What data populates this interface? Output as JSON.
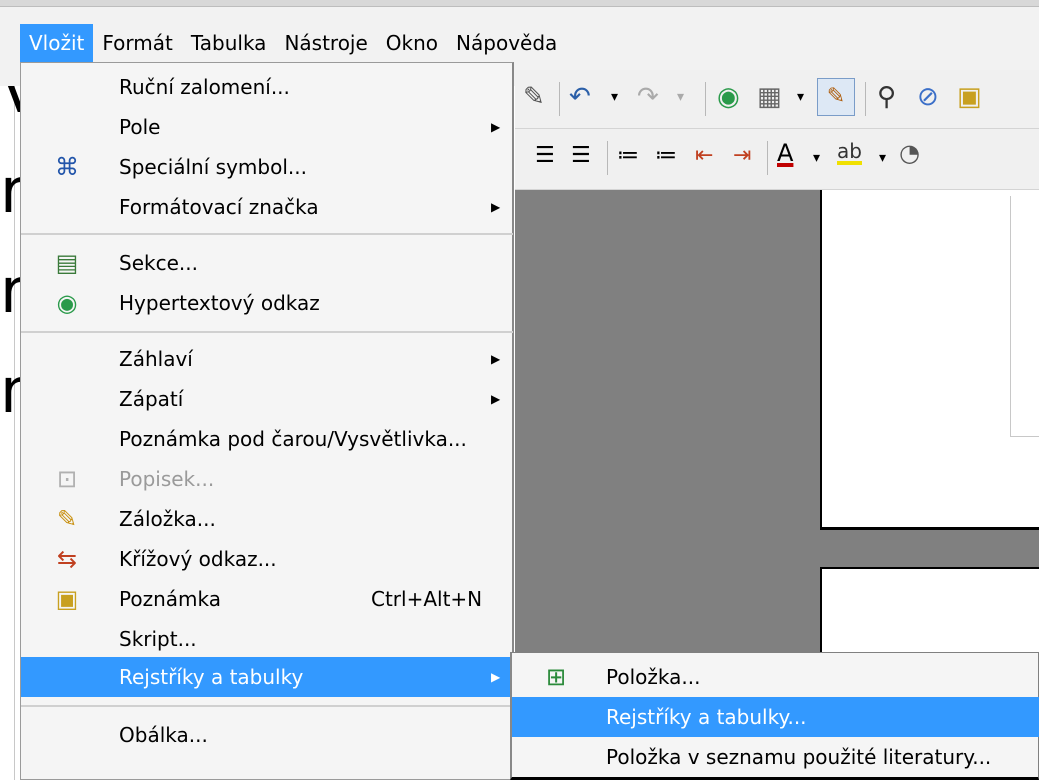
{
  "menubar": {
    "items": [
      {
        "label": "Vložit"
      },
      {
        "label": "Formát"
      },
      {
        "label": "Tabulka"
      },
      {
        "label": "Nástroje"
      },
      {
        "label": "Okno"
      },
      {
        "label": "Nápověda"
      }
    ]
  },
  "background_letters": [
    "V",
    "r",
    "r",
    "m"
  ],
  "dropdown": {
    "items": [
      {
        "label": "Ruční zalomení..."
      },
      {
        "label": "Pole"
      },
      {
        "label": "Speciální symbol..."
      },
      {
        "label": "Formátovací značka"
      },
      {
        "label": "Sekce..."
      },
      {
        "label": "Hypertextový odkaz"
      },
      {
        "label": "Záhlaví"
      },
      {
        "label": "Zápatí"
      },
      {
        "label": "Poznámka pod čarou/Vysvětlivka..."
      },
      {
        "label": "Popisek..."
      },
      {
        "label": "Záložka..."
      },
      {
        "label": "Křížový odkaz..."
      },
      {
        "label": "Poznámka",
        "shortcut": "Ctrl+Alt+N"
      },
      {
        "label": "Skript..."
      },
      {
        "label": "Rejstříky a tabulky"
      },
      {
        "label": "Obálka..."
      }
    ]
  },
  "submenu": {
    "items": [
      {
        "label": "Položka..."
      },
      {
        "label": "Rejstříky a tabulky..."
      },
      {
        "label": "Položka v seznamu použité literatury..."
      }
    ]
  },
  "colors": {
    "highlight": "#3399ff",
    "menu_bg": "#f5f5f5",
    "doc_bg": "#808080"
  }
}
